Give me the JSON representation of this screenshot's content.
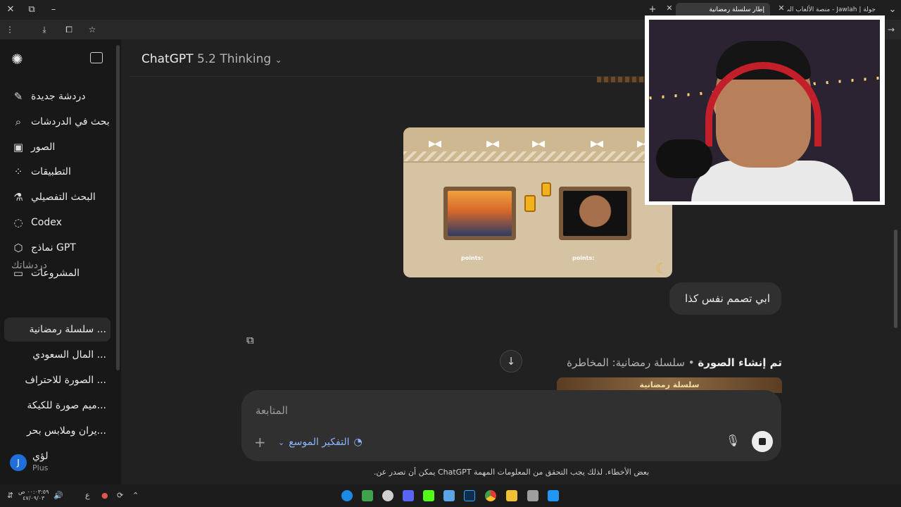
{
  "browser": {
    "tabs": [
      {
        "label": "إطار سلسلة رمضانية",
        "active": true
      },
      {
        "label": "جولة | Jawlah - منصة الألعاب الت",
        "active": false
      }
    ],
    "new_tab_label": "+",
    "profile_initial": "J"
  },
  "sidebar": {
    "items": [
      {
        "label": "دردشة جديدة",
        "icon": "new-chat-icon",
        "glyph": "✎"
      },
      {
        "label": "بحث في الدردشات",
        "icon": "search-icon",
        "glyph": "⌕"
      },
      {
        "label": "الصور",
        "icon": "images-icon",
        "glyph": "▣"
      },
      {
        "label": "التطبيقات",
        "icon": "apps-icon",
        "glyph": "⁘"
      },
      {
        "label": "البحث التفصيلي",
        "icon": "deep-research-icon",
        "glyph": "⚗"
      },
      {
        "label": "Codex",
        "icon": "codex-icon",
        "glyph": "◌"
      },
      {
        "label": "نماذج GPT",
        "icon": "gpts-icon",
        "glyph": "⬡"
      },
      {
        "label": "المشروعات",
        "icon": "projects-icon",
        "glyph": "▭"
      }
    ],
    "section_label": "دردشاتك",
    "chats": [
      "... سلسلة رمضانية",
      "... المال السعودي",
      "... الصورة للاحتراف",
      "...ميم صورة للكيكة",
      "...يران وملابس بحر"
    ],
    "user": {
      "initial": "J",
      "name": "لؤي",
      "plan": "Plus"
    }
  },
  "header": {
    "model": "ChatGPT",
    "version": "5.2 Thinking"
  },
  "conversation": {
    "image_points_label": "points:",
    "user_message": "ابي تصمم نفس كذا",
    "generated_status": "تم إنشاء الصورة",
    "generated_title": "سلسلة رمضانية: المخاطرة",
    "generated_banner": "سلسلة رمضانية"
  },
  "composer": {
    "placeholder": "المتابعة",
    "thinking_mode": "التفكير الموسع"
  },
  "disclaimer": "بعض الأخطاء. لذلك يجب التحقق من المعلومات المهمة ChatGPT يمكن أن تصدر عن.",
  "taskbar": {
    "time": "٠٠:٠٣:٥٩ ص",
    "date": "٤٧/٠٩/٠٣",
    "lang": "ع"
  }
}
